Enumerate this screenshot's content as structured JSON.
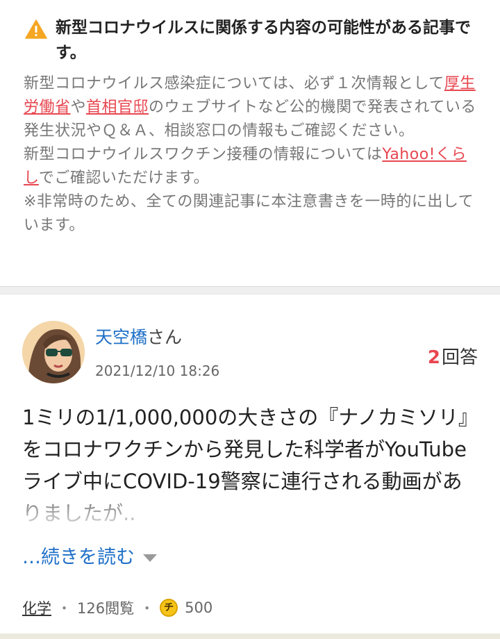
{
  "notice": {
    "title": "新型コロナウイルスに関係する内容の可能性がある記事です。",
    "line1": "新型コロナウイルス感染症については、必ず１次情報として",
    "link_mhlw": "厚生労働省",
    "conj": "や",
    "link_kantei": "首相官邸",
    "line2_rest": "のウェブサイトなど公的機関で発表されている発生状況やＱ＆Ａ、相談窓口の情報もご確認ください。",
    "vaccine_prefix": "新型コロナウイルスワクチン接種の情報については",
    "link_yahoo": "Yahoo!くらし",
    "vaccine_suffix": "でご確認いただけます。",
    "note": "※非常時のため、全ての関連記事に本注意書きを一時的に出しています。",
    "warning_color": "#f5a623",
    "link_color": "#e8464f"
  },
  "post": {
    "user_name": "天空橋",
    "user_suffix": "さん",
    "timestamp": "2021/12/10 18:26",
    "answer_count": "2",
    "answer_label": "回答",
    "question": "1ミリの1/1,000,000の大きさの『ナノカミソリ』をコロナワクチンから発見した科学者がYouTubeライブ中にCOVID-19警察に連行される動画がありましたが..",
    "read_more": "…続きを読む",
    "category": "化学",
    "views": "126閲覧",
    "coin_glyph": "チ",
    "coins": "500"
  }
}
